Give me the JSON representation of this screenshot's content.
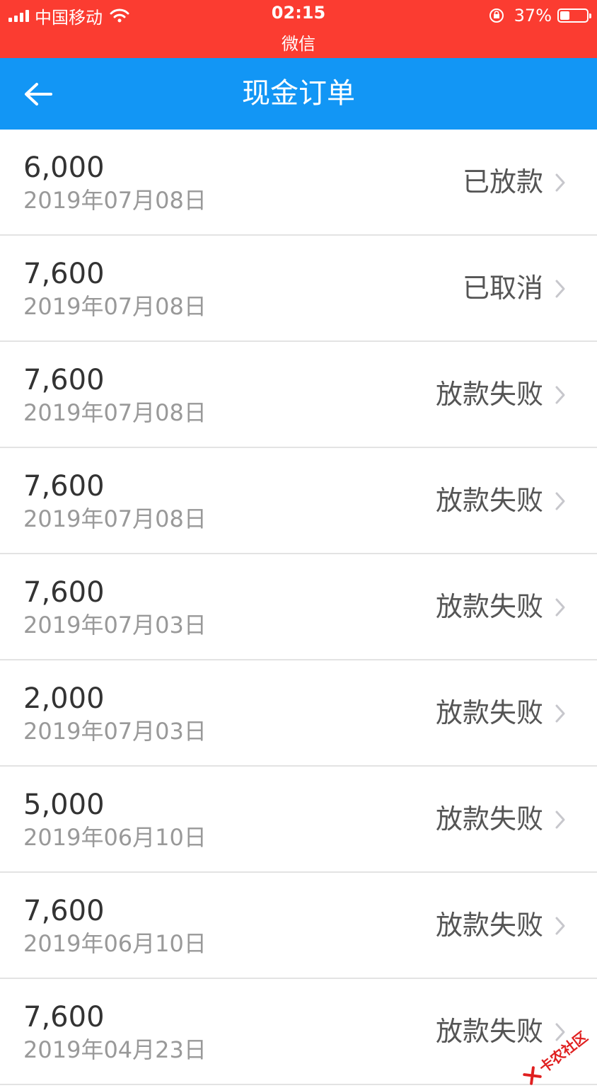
{
  "status_bar": {
    "carrier": "中国移动",
    "time": "02:15",
    "app_name": "微信",
    "battery": "37%",
    "battery_level": 0.37,
    "background_color": "#fb3c31"
  },
  "nav": {
    "title": "现金订单",
    "back_icon": "arrow-left-icon",
    "background_color": "#1296f5"
  },
  "orders": [
    {
      "amount": "6,000",
      "date": "2019年07月08日",
      "status": "已放款"
    },
    {
      "amount": "7,600",
      "date": "2019年07月08日",
      "status": "已取消"
    },
    {
      "amount": "7,600",
      "date": "2019年07月08日",
      "status": "放款失败"
    },
    {
      "amount": "7,600",
      "date": "2019年07月08日",
      "status": "放款失败"
    },
    {
      "amount": "7,600",
      "date": "2019年07月03日",
      "status": "放款失败"
    },
    {
      "amount": "2,000",
      "date": "2019年07月03日",
      "status": "放款失败"
    },
    {
      "amount": "5,000",
      "date": "2019年06月10日",
      "status": "放款失败"
    },
    {
      "amount": "7,600",
      "date": "2019年06月10日",
      "status": "放款失败"
    },
    {
      "amount": "7,600",
      "date": "2019年04月23日",
      "status": "放款失败"
    }
  ],
  "watermark": {
    "text": "卡农社区",
    "color": "#e02020"
  }
}
